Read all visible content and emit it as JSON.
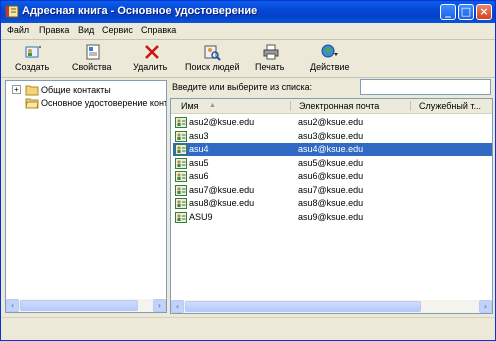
{
  "window": {
    "title": "Адресная книга - Основное удостоверение"
  },
  "menu": [
    "Файл",
    "Правка",
    "Вид",
    "Сервис",
    "Справка"
  ],
  "toolbar": [
    {
      "label": "Создать",
      "icon": "new-contact-icon"
    },
    {
      "label": "Свойства",
      "icon": "properties-icon"
    },
    {
      "label": "Удалить",
      "icon": "delete-icon"
    },
    {
      "label": "Поиск людей",
      "icon": "find-people-icon"
    },
    {
      "label": "Печать",
      "icon": "print-icon"
    },
    {
      "label": "Действие",
      "icon": "action-icon"
    }
  ],
  "tree": {
    "items": [
      {
        "label": "Общие контакты",
        "expander": "+"
      },
      {
        "label": "Основное удостоверение конт"
      }
    ]
  },
  "search": {
    "label": "Введите или выберите из списка:",
    "value": ""
  },
  "list": {
    "columns": [
      "Имя",
      "Электронная почта",
      "Служебный т..."
    ],
    "rows": [
      {
        "name": "asu2@ksue.edu",
        "email": "asu2@ksue.edu",
        "selected": false
      },
      {
        "name": "asu3",
        "email": "asu3@ksue.edu",
        "selected": false
      },
      {
        "name": "asu4",
        "email": "asu4@ksue.edu",
        "selected": true
      },
      {
        "name": "asu5",
        "email": "asu5@ksue.edu",
        "selected": false
      },
      {
        "name": "asu6",
        "email": "asu6@ksue.edu",
        "selected": false
      },
      {
        "name": "asu7@ksue.edu",
        "email": "asu7@ksue.edu",
        "selected": false
      },
      {
        "name": "asu8@ksue.edu",
        "email": "asu8@ksue.edu",
        "selected": false
      },
      {
        "name": "ASU9",
        "email": "asu9@ksue.edu",
        "selected": false
      }
    ]
  },
  "colors": {
    "selection": "#316ac5",
    "titlebar": "#0546d2"
  }
}
